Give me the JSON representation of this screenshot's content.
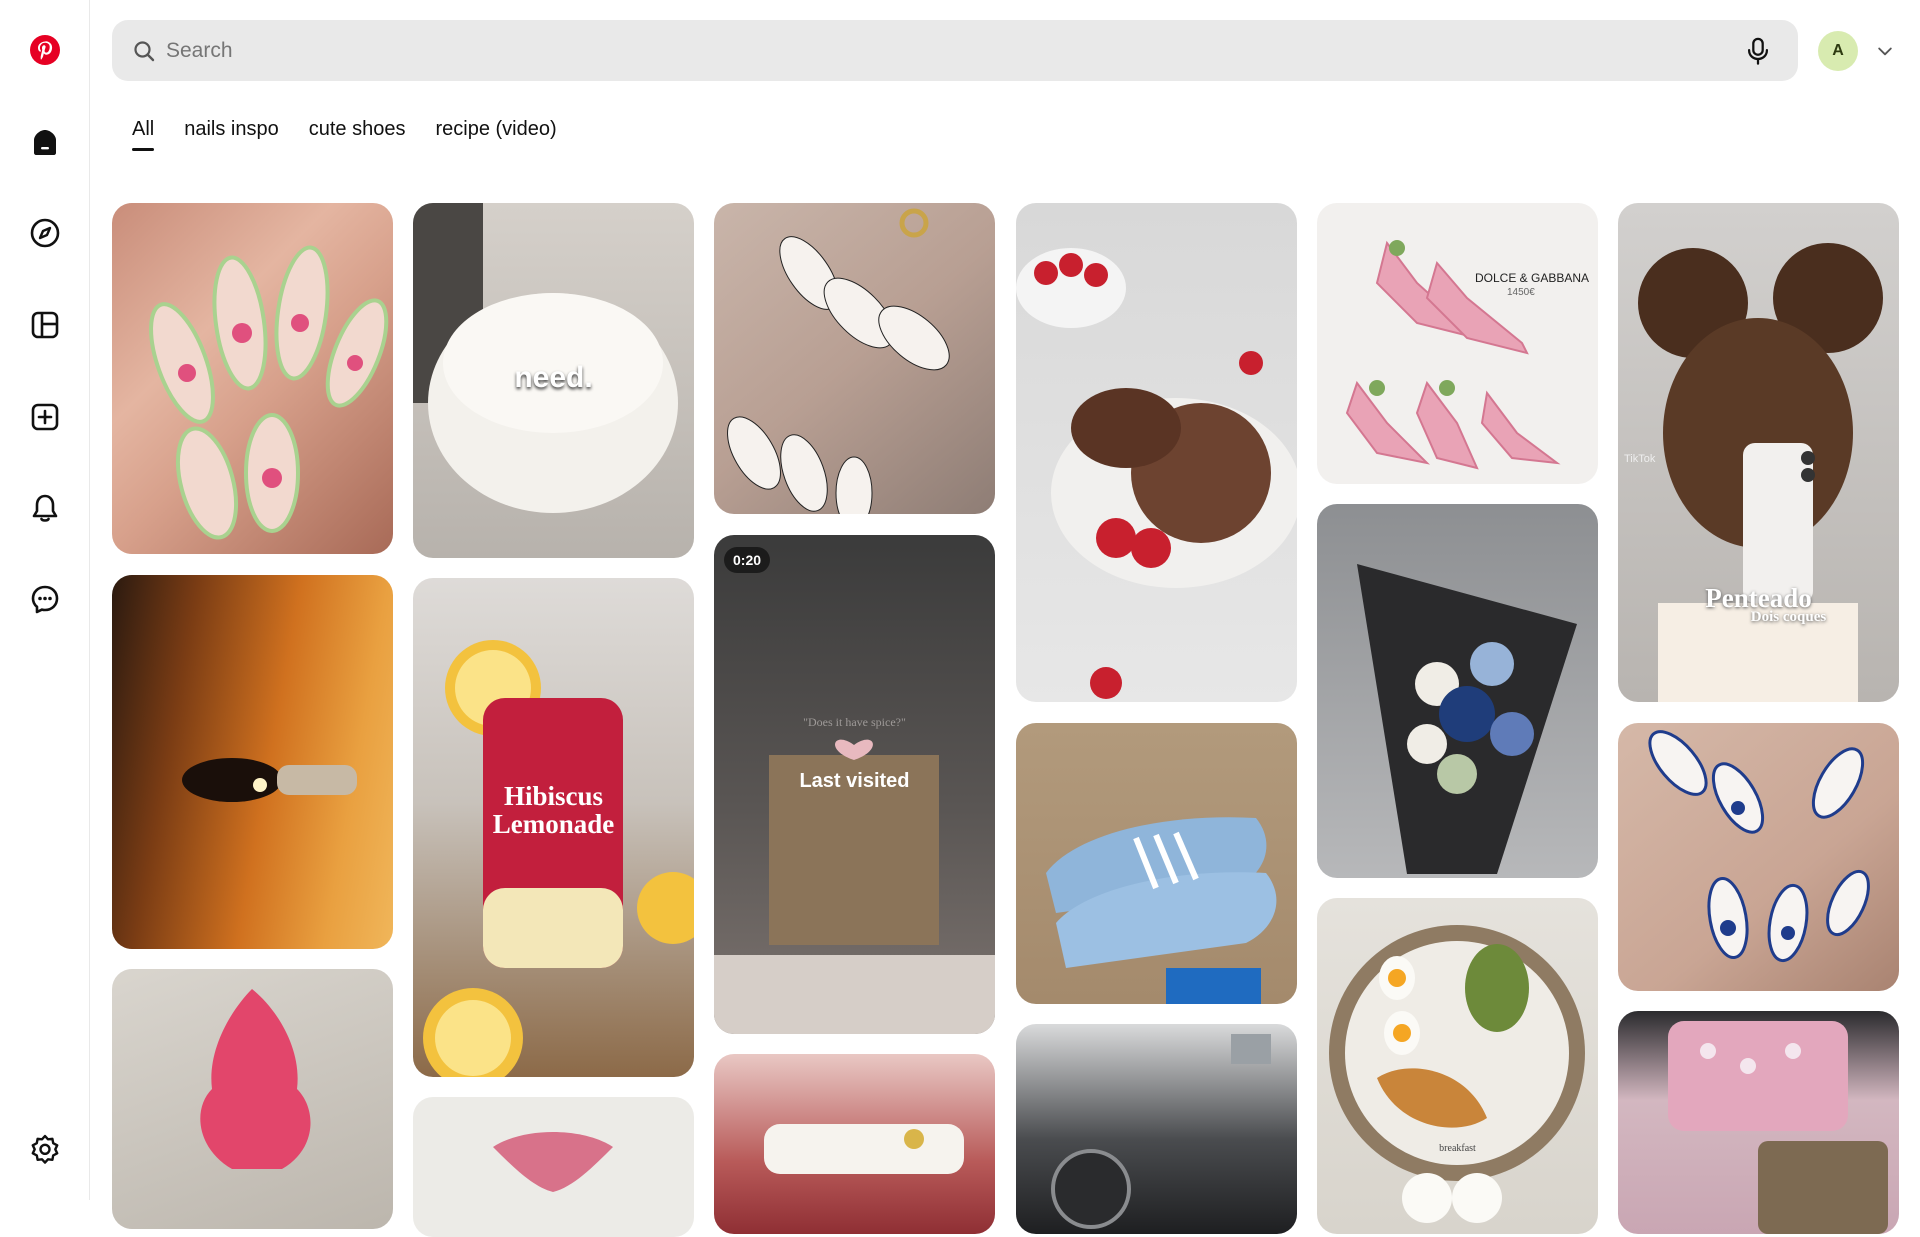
{
  "search": {
    "placeholder": "Search"
  },
  "account": {
    "initial": "A",
    "avatar_color": "#d8ebb0"
  },
  "brand": {
    "color": "#e60023"
  },
  "tabs": [
    {
      "label": "All",
      "active": true
    },
    {
      "label": "nails inspo"
    },
    {
      "label": "cute shoes"
    },
    {
      "label": "recipe (video)"
    }
  ],
  "sidebar": {
    "items": [
      {
        "name": "home"
      },
      {
        "name": "explore"
      },
      {
        "name": "boards"
      },
      {
        "name": "create"
      },
      {
        "name": "notifications"
      },
      {
        "name": "messages"
      },
      {
        "name": "settings"
      }
    ]
  },
  "pins": {
    "bed_text": "need.",
    "lemonade_text": "Hibiscus\nLemonade",
    "video_duration": "0:20",
    "last_visited": "Last visited",
    "video_caption": "\"Does it have spice?\"",
    "shoes_brand": "DOLCE & GABBANA",
    "shoes_price": "1450€",
    "hair_title": "Penteado",
    "hair_subtitle": "Dois coques",
    "hair_watermark": "TikTok",
    "food_caption": "breakfast"
  }
}
